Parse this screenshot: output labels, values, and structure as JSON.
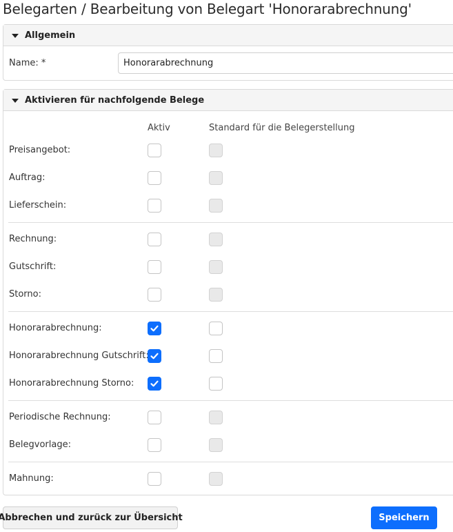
{
  "page": {
    "title": "Belegarten / Bearbeitung von Belegart 'Honorarabrechnung'"
  },
  "allgemein": {
    "header": "Allgemein",
    "name_label": "Name: *",
    "name_value": "Honorarabrechnung"
  },
  "aktivieren": {
    "header": "Aktivieren für nachfolgende Belege",
    "col_aktiv": "Aktiv",
    "col_standard": "Standard für die Belegerstellung",
    "rows": [
      {
        "label": "Preisangebot:",
        "aktiv": false,
        "standard": false,
        "standard_enabled": false
      },
      {
        "label": "Auftrag:",
        "aktiv": false,
        "standard": false,
        "standard_enabled": false
      },
      {
        "label": "Lieferschein:",
        "aktiv": false,
        "standard": false,
        "standard_enabled": false
      },
      {
        "label": "Rechnung:",
        "aktiv": false,
        "standard": false,
        "standard_enabled": false
      },
      {
        "label": "Gutschrift:",
        "aktiv": false,
        "standard": false,
        "standard_enabled": false
      },
      {
        "label": "Storno:",
        "aktiv": false,
        "standard": false,
        "standard_enabled": false
      },
      {
        "label": "Honorarabrechnung:",
        "aktiv": true,
        "standard": false,
        "standard_enabled": true
      },
      {
        "label": "Honorarabrechnung Gutschrift:",
        "aktiv": true,
        "standard": false,
        "standard_enabled": true
      },
      {
        "label": "Honorarabrechnung Storno:",
        "aktiv": true,
        "standard": false,
        "standard_enabled": true
      },
      {
        "label": "Periodische Rechnung:",
        "aktiv": false,
        "standard": false,
        "standard_enabled": false
      },
      {
        "label": "Belegvorlage:",
        "aktiv": false,
        "standard": false,
        "standard_enabled": false
      },
      {
        "label": "Mahnung:",
        "aktiv": false,
        "standard": false,
        "standard_enabled": false
      }
    ]
  },
  "buttons": {
    "cancel": "Abbrechen und zurück zur Übersicht",
    "save": "Speichern"
  },
  "colors": {
    "accent": "#0d6efd"
  },
  "icons": {
    "collapse": "caret-down-icon",
    "check": "checkmark-icon"
  }
}
